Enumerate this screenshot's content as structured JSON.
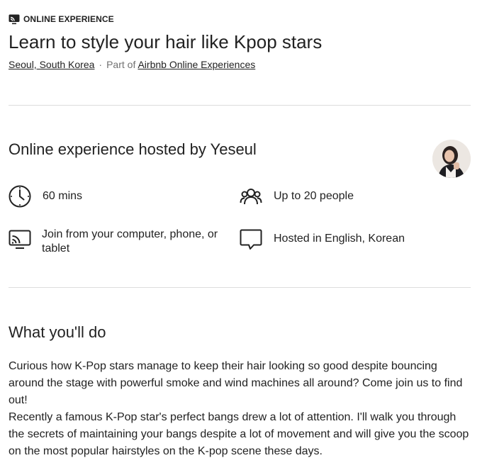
{
  "header": {
    "badge_icon": "screen-icon",
    "badge_label": "ONLINE EXPERIENCE",
    "title": "Learn to style your hair like Kpop stars",
    "location": "Seoul, South Korea",
    "separator": "·",
    "part_of_prefix": "Part of",
    "collection_link": "Airbnb Online Experiences"
  },
  "host": {
    "heading": "Online experience hosted by Yeseul",
    "avatar_icon": "host-avatar"
  },
  "features": [
    {
      "icon": "clock-icon",
      "label": "60 mins"
    },
    {
      "icon": "people-icon",
      "label": "Up to 20 people"
    },
    {
      "icon": "devices-icon",
      "label": "Join from your computer, phone, or tablet"
    },
    {
      "icon": "chat-bubble-icon",
      "label": "Hosted in English, Korean"
    }
  ],
  "what_youll_do": {
    "heading": "What you'll do",
    "paragraphs": [
      "Curious how K-Pop stars manage to keep their hair looking so good despite bouncing around the stage with powerful smoke and wind machines all around? Come join us to find out!",
      "Recently a famous K-Pop star's perfect bangs drew a lot of attention. I'll walk you through the secrets of maintaining your bangs despite a lot of movement and will give you the scoop on the most popular hairstyles on the K-pop scene these days."
    ]
  }
}
